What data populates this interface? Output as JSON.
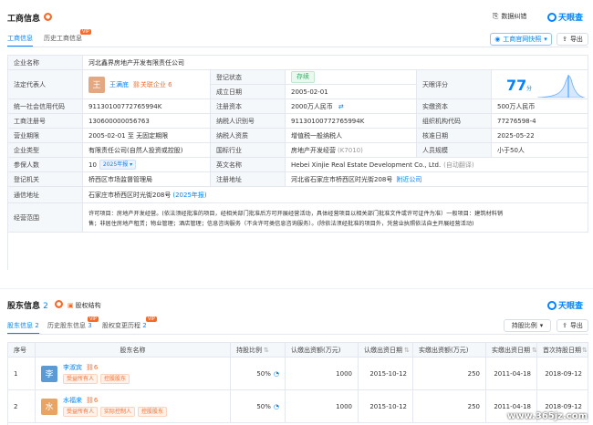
{
  "business_info": {
    "title": "工商信息",
    "tabs": [
      {
        "label": "工商信息",
        "active": true
      },
      {
        "label": "历史工商信息",
        "badge": "VIP",
        "active": false
      }
    ],
    "data_report_label": "数据纠错",
    "brand": "天眼查",
    "official_snapshot_label": "工商官网快照",
    "export_label": "导出"
  },
  "fields": {
    "company_name_label": "企业名称",
    "company_name": "河北鑫界房地产开发有限责任公司",
    "legal_rep_label": "法定代表人",
    "legal_rep_avatar": "王",
    "legal_rep_name": "王满底",
    "legal_rep_related": "关联企业",
    "legal_rep_related_count": "6",
    "reg_status_label": "登记状态",
    "reg_status": "存续",
    "found_date_label": "成立日期",
    "found_date": "2005-02-01",
    "score_label": "天眼评分",
    "score": "77",
    "score_unit": "分",
    "credit_code_label": "统一社会信用代码",
    "credit_code": "91130100772765994K",
    "reg_capital_label": "注册资本",
    "reg_capital": "2000万人民币",
    "paid_capital_label": "实缴资本",
    "paid_capital": "500万人民币",
    "reg_no_label": "工商注册号",
    "reg_no": "130600000056763",
    "taxpayer_id_label": "纳税人识别号",
    "taxpayer_id": "91130100772765994K",
    "org_code_label": "组织机构代码",
    "org_code": "77276598-4",
    "term_label": "营业期限",
    "term": "2005-02-01 至 无固定期限",
    "taxpayer_qual_label": "纳税人资质",
    "taxpayer_qual": "增值税一般纳税人",
    "approve_date_label": "核准日期",
    "approve_date": "2025-05-22",
    "type_label": "企业类型",
    "type": "有限责任公司(自然人投资或控股)",
    "industry_label": "国标行业",
    "industry": "房地产开发经营",
    "industry_code": "(K7010)",
    "staff_size_label": "人员规模",
    "staff_size": "小于50人",
    "insured_label": "参保人数",
    "insured": "10",
    "insured_year": "2025年报",
    "en_name_label": "英文名称",
    "en_name": "Hebei Xinjie Real Estate Development Co., Ltd.",
    "en_name_note": "(自动翻译)",
    "reg_authority_label": "登记机关",
    "reg_authority": "桥西区市场监督管理局",
    "reg_address_label": "注册地址",
    "reg_address": "河北省石家庄市桥西区时光街208号",
    "nearby_label": "附近公司",
    "mail_address_label": "通信地址",
    "mail_address": "石家庄市桥西区时光街208号",
    "mail_year": "(2025年报)",
    "scope_label": "经营范围",
    "scope_line1": "许可项目：房地产开发经营。(依法须经批准的项目，经相关部门批准后方可开展经营活动，具体经营项目以相关部门批准文件或许可证件为准）一般项目：建筑材料销",
    "scope_line2": "售；非居住房地产租赁；物业管理；酒店管理；信息咨询服务（不含许可类信息咨询服务）。(除依法须经批准的项目外，凭营业执照依法自主开展经营活动)"
  },
  "shareholders": {
    "title": "股东信息",
    "title_count": "2",
    "equity_label": "股权结构",
    "brand": "天眼查",
    "tabs": [
      {
        "label": "股东信息",
        "count": "2",
        "active": true
      },
      {
        "label": "历史股东信息",
        "count": "3",
        "badge": "VIP",
        "active": false
      },
      {
        "label": "股权变更历程",
        "count": "2",
        "badge": "VIP",
        "active": false
      }
    ],
    "sort_label": "持股比例",
    "export_label": "导出",
    "columns": [
      "序号",
      "股东名称",
      "持股比例",
      "认缴出资额(万元)",
      "认缴出资日期",
      "实缴出资额(万元)",
      "实缴出资日期",
      "首次持股日期"
    ],
    "rows": [
      {
        "no": "1",
        "avatar": "李",
        "avatar_color": "#5b9bd5",
        "name": "李淑宾",
        "count": "6",
        "tags": [
          "受益所有人",
          "控股股东"
        ],
        "ratio": "50%",
        "sub_amount": "1000",
        "sub_date": "2015-10-12",
        "paid_amount": "250",
        "paid_date": "2011-04-18",
        "first_date": "2018-09-12"
      },
      {
        "no": "2",
        "avatar": "水",
        "avatar_color": "#e8a463",
        "name": "水福来",
        "count": "6",
        "tags": [
          "受益所有人",
          "实际控制人",
          "控股股东"
        ],
        "ratio": "50%",
        "sub_amount": "1000",
        "sub_date": "2015-10-12",
        "paid_amount": "250",
        "paid_date": "2011-04-18",
        "first_date": "2018-09-12"
      }
    ]
  },
  "watermark": "www.365jz.com",
  "colors": {
    "accent": "#0084ff",
    "label_bg": "#f5f8fb",
    "border": "#e4e8ee",
    "green": "#2bb360",
    "orange": "#f56b2a"
  }
}
